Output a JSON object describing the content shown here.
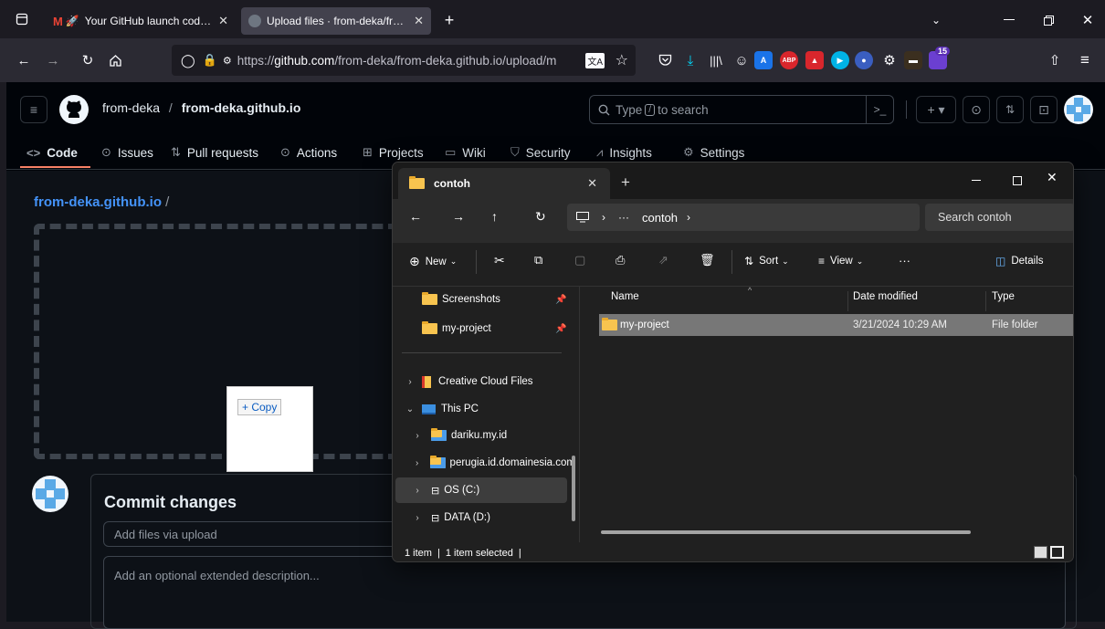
{
  "browser": {
    "tabs": [
      {
        "title": "Your GitHub launch code - c",
        "active": false
      },
      {
        "title": "Upload files · from-deka/from-c",
        "active": true
      }
    ],
    "url": "https://github.com/from-deka/from-deka.github.io/upload/m",
    "url_host_prefix": "https://",
    "url_bold": "github.com",
    "url_rest": "/from-deka/from-deka.github.io/upload/m",
    "extensions_badge": "15",
    "ext_abp": "ABP"
  },
  "github": {
    "owner": "from-deka",
    "separator": "/",
    "repo": "from-deka.github.io",
    "search_placeholder": "Type",
    "search_key": "/",
    "search_suffix": "to search",
    "tabs": [
      {
        "label": "Code",
        "icon": "code-icon"
      },
      {
        "label": "Issues",
        "icon": "issue-icon"
      },
      {
        "label": "Pull requests",
        "icon": "pull-request-icon"
      },
      {
        "label": "Actions",
        "icon": "play-icon"
      },
      {
        "label": "Projects",
        "icon": "table-icon"
      },
      {
        "label": "Wiki",
        "icon": "book-icon"
      },
      {
        "label": "Security",
        "icon": "shield-icon"
      },
      {
        "label": "Insights",
        "icon": "graph-icon"
      },
      {
        "label": "Settings",
        "icon": "gear-icon"
      }
    ],
    "breadcrumb_repo": "from-deka.github.io",
    "breadcrumb_sep": "/",
    "drag_copy_label": "+ Copy",
    "commit_title": "Commit changes",
    "commit_summary_placeholder": "Add files via upload",
    "commit_desc_placeholder": "Add an optional extended description..."
  },
  "explorer": {
    "tab_title": "contoh",
    "path_more": "···",
    "path_current": "contoh",
    "search_placeholder": "Search contoh",
    "toolbar": {
      "new": "New",
      "sort": "Sort",
      "view": "View",
      "more": "···",
      "details": "Details"
    },
    "quick_access": [
      {
        "label": "Screenshots",
        "pinned": true
      },
      {
        "label": "my-project",
        "pinned": true
      }
    ],
    "tree": [
      {
        "label": "Creative Cloud Files",
        "icon": "creative-cloud-icon",
        "expanded": false,
        "indent": 0
      },
      {
        "label": "This PC",
        "icon": "this-pc-icon",
        "expanded": true,
        "indent": 0
      },
      {
        "label": "dariku.my.id",
        "icon": "network-folder-icon",
        "expanded": false,
        "indent": 1
      },
      {
        "label": "perugia.id.domainesia.com",
        "icon": "network-folder-icon",
        "expanded": false,
        "indent": 1
      },
      {
        "label": "OS (C:)",
        "icon": "drive-c-icon",
        "expanded": false,
        "indent": 1,
        "selected": true
      },
      {
        "label": "DATA (D:)",
        "icon": "drive-icon",
        "expanded": false,
        "indent": 1
      }
    ],
    "columns": {
      "name": "Name",
      "date": "Date modified",
      "type": "Type"
    },
    "files": [
      {
        "name": "my-project",
        "date": "3/21/2024 10:29 AM",
        "type": "File folder",
        "selected": true
      }
    ],
    "status_count": "1 item",
    "status_selected": "1 item selected",
    "status_sep": "|"
  },
  "colors": {
    "gh_link": "#4493f8",
    "folder": "#f8c44f",
    "selected_row": "#777777"
  }
}
